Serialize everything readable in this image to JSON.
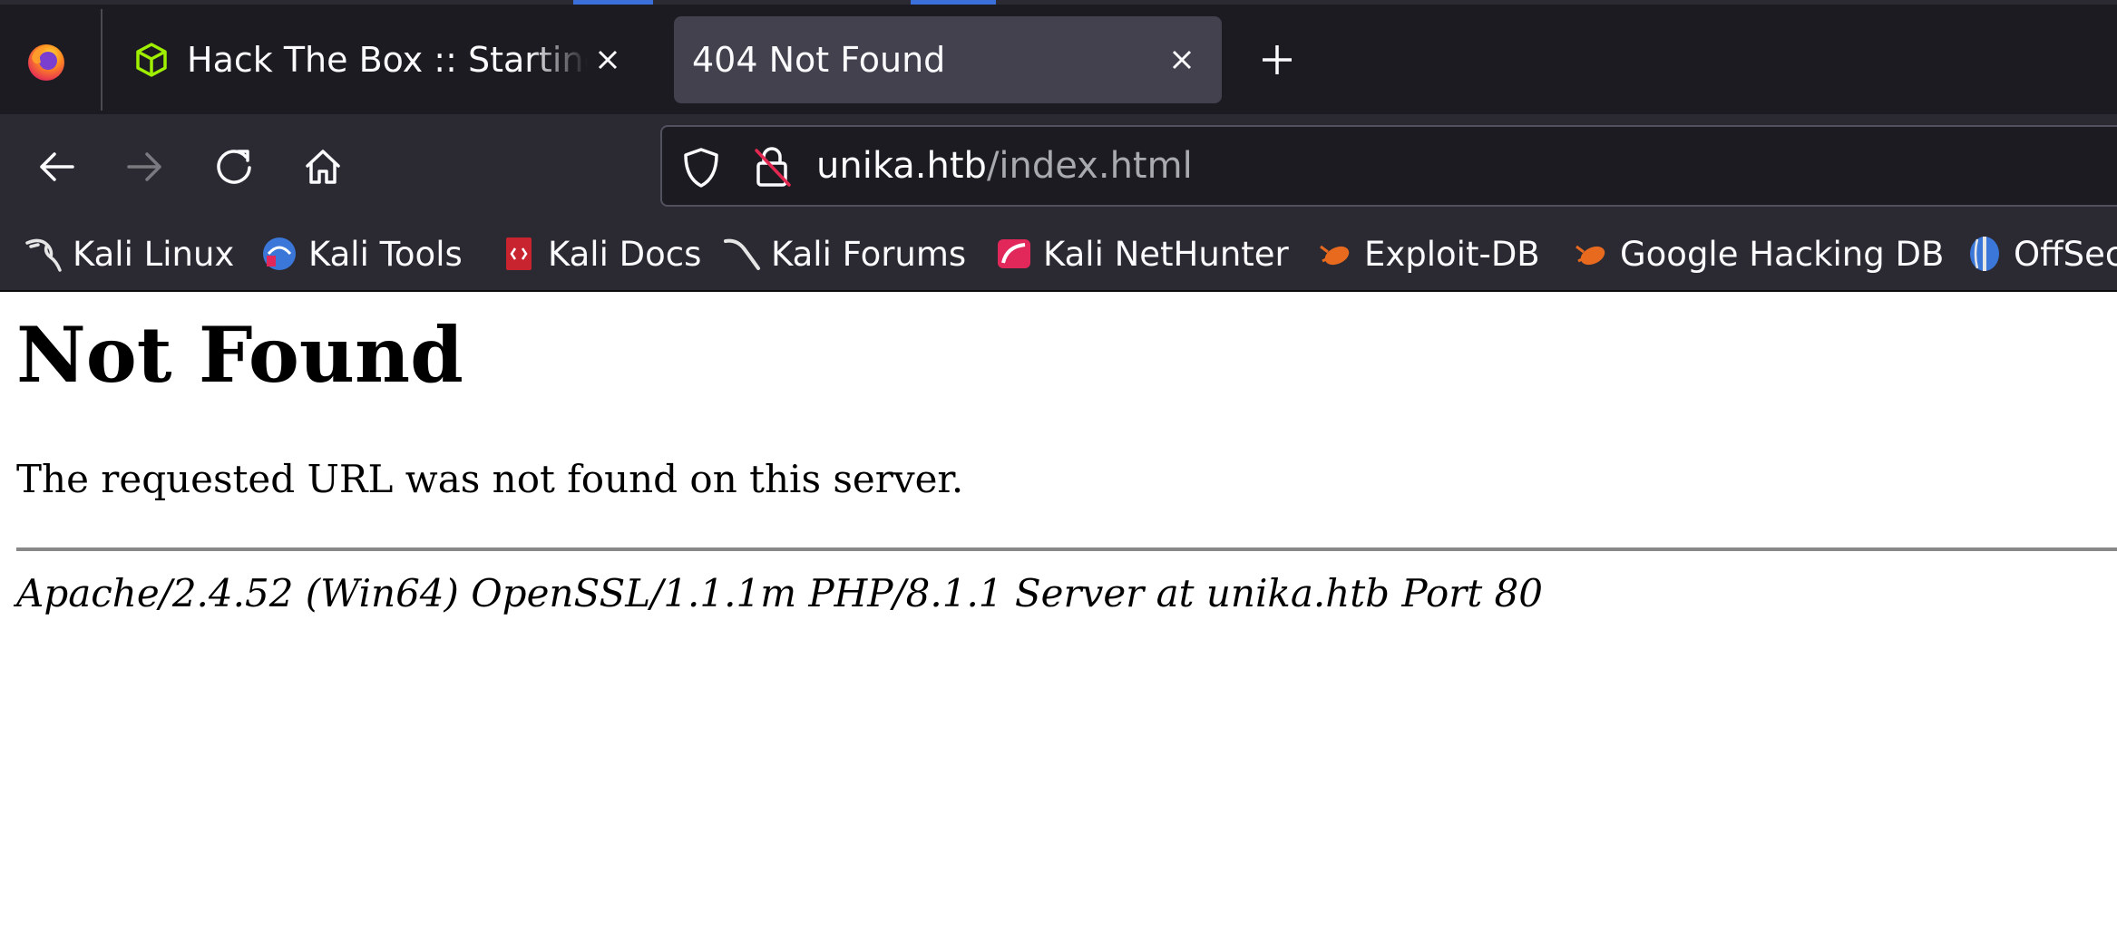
{
  "tabs": [
    {
      "title": "Hack The Box :: Starting Point",
      "active": false,
      "favicon": "htb-cube-icon"
    },
    {
      "title": "404 Not Found",
      "active": true,
      "favicon": null
    }
  ],
  "navbar": {
    "url_host": "unika.htb",
    "url_path": "/index.html"
  },
  "bookmarks": [
    {
      "label": "Kali Linux",
      "icon": "kali-dragon-icon"
    },
    {
      "label": "Kali Tools",
      "icon": "kali-tools-icon"
    },
    {
      "label": "Kali Docs",
      "icon": "kali-docs-icon"
    },
    {
      "label": "Kali Forums",
      "icon": "kali-forums-icon"
    },
    {
      "label": "Kali NetHunter",
      "icon": "kali-nethunter-icon"
    },
    {
      "label": "Exploit-DB",
      "icon": "exploit-db-icon"
    },
    {
      "label": "Google Hacking DB",
      "icon": "ghdb-icon"
    },
    {
      "label": "OffSec",
      "icon": "offsec-icon"
    }
  ],
  "page": {
    "heading": "Not Found",
    "message": "The requested URL was not found on this server.",
    "address": "Apache/2.4.52 (Win64) OpenSSL/1.1.1m PHP/8.1.1 Server at unika.htb Port 80"
  },
  "colors": {
    "toolbar": "#2b2a33",
    "tabstrip": "#1c1b22",
    "active_tab": "#42414d",
    "url_path": "#a9a9b0"
  }
}
